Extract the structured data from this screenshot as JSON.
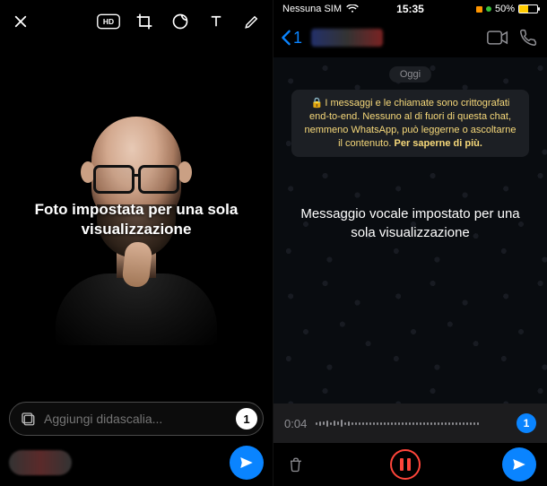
{
  "left": {
    "overlay_text": "Foto impostata per una sola visualizzazione",
    "caption_placeholder": "Aggiungi didascalia...",
    "viewonce_badge": "1"
  },
  "right": {
    "status": {
      "carrier": "Nessuna SIM",
      "time": "15:35",
      "battery_pct": "50%"
    },
    "nav": {
      "back_count": "1"
    },
    "date_label": "Oggi",
    "encryption_text": "I messaggi e le chiamate sono crittografati end-to-end. Nessuno al di fuori di questa chat, nemmeno WhatsApp, può leggerne o ascoltarne il contenuto.",
    "encryption_link": "Per saperne di più.",
    "voice_overlay_text": "Messaggio vocale impostato per una sola visualizzazione",
    "voice_time": "0:04",
    "viewonce_badge": "1"
  }
}
